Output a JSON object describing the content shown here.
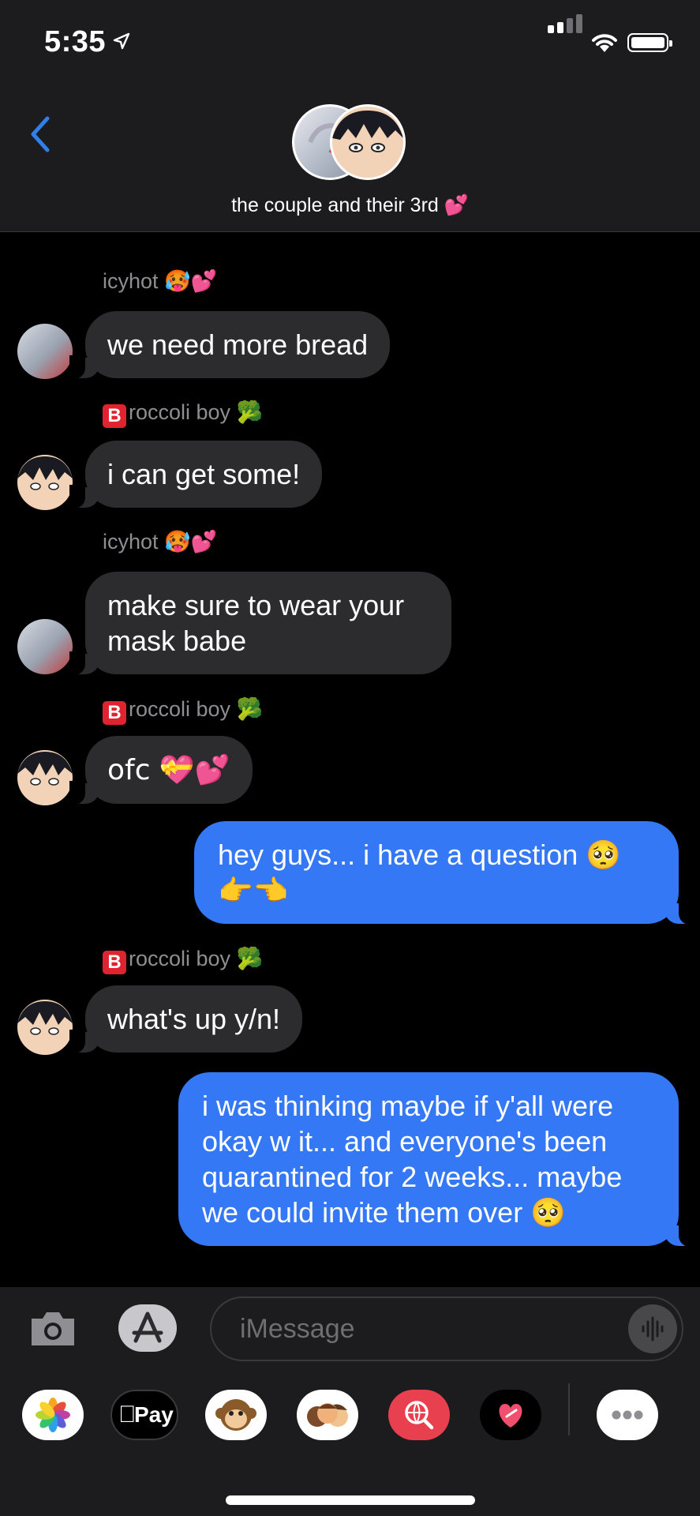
{
  "status_bar": {
    "time": "5:35",
    "location_icon": "location-arrow-icon",
    "signal_icon": "cellular-signal-icon",
    "wifi_icon": "wifi-icon",
    "battery_icon": "battery-icon"
  },
  "header": {
    "group_name": "the couple and their 3rd 💕",
    "back_icon": "chevron-left-icon"
  },
  "colors": {
    "outgoing_bubble": "#3478f6",
    "incoming_bubble": "#2c2c2e",
    "background": "#000000",
    "header": "#1c1c1e",
    "accent": "#2f80ed"
  },
  "messages": [
    {
      "sender": "icyhot 🥵💕",
      "text": "we need more bread",
      "direction": "incoming"
    },
    {
      "sender_letter": "B",
      "sender": "roccoli boy 🥦",
      "text": "i can get some!",
      "direction": "incoming"
    },
    {
      "sender": "icyhot 🥵💕",
      "text": "make sure to wear your mask babe",
      "direction": "incoming"
    },
    {
      "sender_letter": "B",
      "sender": "roccoli boy 🥦",
      "text": "ofc 💝💕",
      "direction": "incoming"
    },
    {
      "text": "hey guys... i have a question 🥺 👉👈",
      "direction": "outgoing"
    },
    {
      "sender_letter": "B",
      "sender": "roccoli boy 🥦",
      "text": "what's up y/n!",
      "direction": "incoming"
    },
    {
      "text": "i was thinking maybe if y'all were okay w it... and everyone's been quarantined for 2 weeks... maybe we could invite them over 🥺",
      "direction": "outgoing"
    }
  ],
  "composer": {
    "placeholder": "iMessage",
    "camera_icon": "camera-icon",
    "appstore_icon": "app-store-icon",
    "audio_icon": "audio-waveform-icon"
  },
  "app_drawer": [
    {
      "name": "photos-app",
      "icon": "photos-flower-icon"
    },
    {
      "name": "apple-pay",
      "label": "Pay",
      "icon": "apple-pay-icon"
    },
    {
      "name": "animoji",
      "icon": "monkey-icon"
    },
    {
      "name": "memoji-stickers",
      "icon": "memoji-icon"
    },
    {
      "name": "images-search",
      "icon": "globe-search-icon"
    },
    {
      "name": "digital-touch",
      "icon": "heart-touch-icon"
    },
    {
      "name": "more-apps",
      "icon": "more-dots-icon"
    }
  ]
}
